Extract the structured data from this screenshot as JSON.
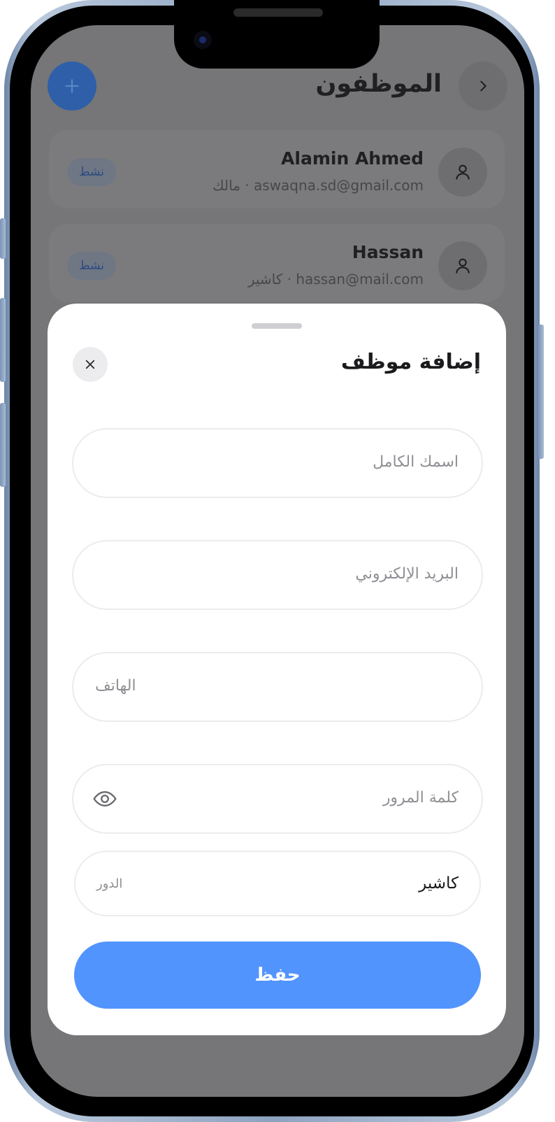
{
  "header": {
    "title": "الموظفون"
  },
  "employees": [
    {
      "name": "Alamin Ahmed",
      "subtitle": "aswaqna.sd@gmail.com · مالك",
      "status": "نشط"
    },
    {
      "name": "Hassan",
      "subtitle": "hassan@mail.com · كاشير",
      "status": "نشط"
    }
  ],
  "sheet": {
    "title": "إضافة موظف",
    "fields": {
      "full_name_placeholder": "اسمك الكامل",
      "email_placeholder": "البريد الإلكتروني",
      "phone_placeholder": "الهاتف",
      "password_placeholder": "كلمة المرور",
      "role_label": "الدور",
      "role_value": "كاشير"
    },
    "save_label": "حفظ"
  },
  "colors": {
    "accent": "#5294fe",
    "add_button": "#2f5fa8",
    "overlay": "#767678"
  }
}
